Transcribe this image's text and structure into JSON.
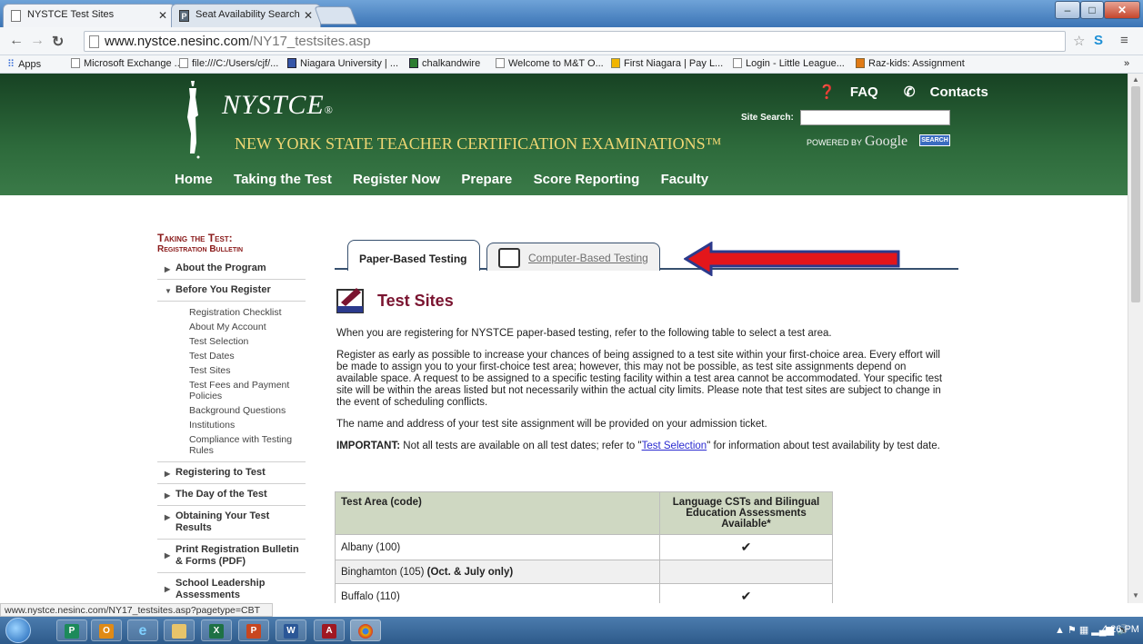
{
  "browser": {
    "tabs": [
      {
        "label": "NYSTCE Test Sites",
        "active": true
      },
      {
        "label": "Seat Availability Search",
        "active": false
      }
    ],
    "window_controls": [
      "–",
      "□",
      "✕"
    ],
    "url_host": "www.nystce.nesinc.com",
    "url_path": "/NY17_testsites.asp",
    "bookmarks": [
      "Apps",
      "Microsoft Exchange ...",
      "file:///C:/Users/cjf/...",
      "Niagara University | ...",
      "chalkandwire",
      "Welcome to M&T O...",
      "First Niagara | Pay L...",
      "Login - Little League...",
      "Raz-kids: Assignment"
    ],
    "bookmarks_overflow": "»",
    "status_url": "www.nystce.nesinc.com/NY17_testsites.asp?pagetype=CBT"
  },
  "header": {
    "logo_text": "NYSTCE",
    "logo_reg": "®",
    "logo_subtitle": "NEW YORK STATE TEACHER CERTIFICATION EXAMINATIONS™",
    "faq_label": "FAQ",
    "contacts_label": "Contacts",
    "site_search_label": "Site Search:",
    "powered_by": "POWERED BY",
    "google_label": "Google",
    "search_button": "SEARCH",
    "nav": [
      "Home",
      "Taking the Test",
      "Register Now",
      "Prepare",
      "Score Reporting",
      "Faculty"
    ]
  },
  "sidebar": {
    "heading_line1": "Taking the Test:",
    "heading_line2": "Registration Bulletin",
    "items": [
      {
        "label": "About the Program",
        "expanded": false
      },
      {
        "label": "Before You Register",
        "expanded": true
      },
      {
        "label": "Registering to Test",
        "expanded": false
      },
      {
        "label": "The Day of the Test",
        "expanded": false
      },
      {
        "label": "Obtaining Your Test Results",
        "expanded": false
      },
      {
        "label": "Print Registration Bulletin & Forms (PDF)",
        "expanded": false
      },
      {
        "label": "School Leadership Assessments",
        "expanded": false
      }
    ],
    "subitems": [
      "Registration Checklist",
      "About My Account",
      "Test Selection",
      "Test Dates",
      "Test Sites",
      "Test Fees and Payment Policies",
      "Background Questions",
      "Institutions",
      "Compliance with Testing Rules"
    ]
  },
  "content_tabs": {
    "paper": "Paper-Based Testing",
    "computer": "Computer-Based Testing"
  },
  "main": {
    "title": "Test Sites",
    "p1": "When you are registering for NYSTCE paper-based testing, refer to the following table to select a test area.",
    "p2": "Register as early as possible to increase your chances of being assigned to a test site within your first-choice area. Every effort will be made to assign you to your first-choice test area; however, this may not be possible, as test site assignments depend on available space. A request to be assigned to a specific testing facility within a test area cannot be accommodated. Your specific test site will be within the areas listed but not necessarily within the actual city limits. Please note that test sites are subject to change in the event of scheduling conflicts.",
    "p3": "The name and address of your test site assignment will be provided on your admission ticket.",
    "important_label": "IMPORTANT:",
    "important_text_1": " Not all tests are available on all test dates; refer to \"",
    "important_link": "Test Selection",
    "important_text_2": "\" for information about test availability by test date."
  },
  "table": {
    "col1": "Test Area (code)",
    "col2": "Language CSTs and Bilingual Education Assessments Available*",
    "rows": [
      {
        "area": "Albany (100)",
        "note": "",
        "check": "✔"
      },
      {
        "area": "Binghamton (105)",
        "note": "(Oct. & July only)",
        "check": ""
      },
      {
        "area": "Buffalo (110)",
        "note": "",
        "check": "✔"
      }
    ]
  },
  "taskbar": {
    "clock": "4:26 PM"
  },
  "colors": {
    "banner_green": "#2d6a3b",
    "title_maroon": "#7a1430",
    "arrow_red": "#e3161b",
    "arrow_outline": "#2b3a8c"
  }
}
